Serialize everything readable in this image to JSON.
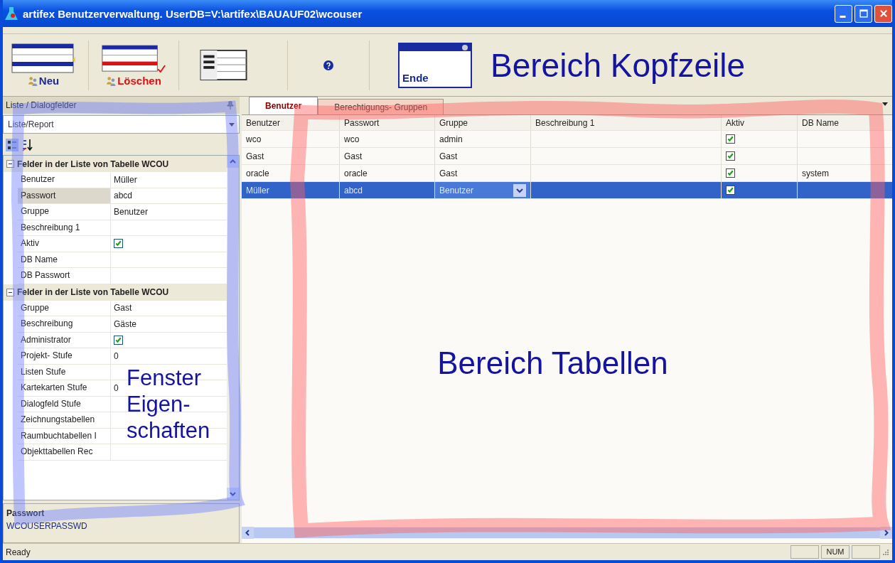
{
  "window": {
    "title": "artifex Benutzerverwaltung. UserDB=V:\\artifex\\BAUAUF02\\wcouser"
  },
  "toolbar": [
    {
      "kind": "new",
      "label": "Neu"
    },
    {
      "kind": "delete",
      "label": "Löschen"
    },
    {
      "kind": "list"
    },
    {
      "kind": "help"
    },
    {
      "kind": "exit",
      "label": "Ende"
    }
  ],
  "annotations": {
    "header": "Bereich Kopfzeile",
    "panel": [
      "Fenster",
      "Eigen-",
      "schaften"
    ],
    "table": "Bereich Tabellen"
  },
  "panel": {
    "title": "Liste / Dialogfelder",
    "dropdown": "Liste/Report",
    "sections": [
      {
        "title": "Felder in der Liste von Tabelle WCOU",
        "expanded": true,
        "rows": [
          {
            "kind": "text",
            "name": "Benutzer",
            "value": "Müller",
            "selected": false
          },
          {
            "kind": "text",
            "name": "Passwort",
            "value": "abcd",
            "selected": true
          },
          {
            "kind": "text",
            "name": "Gruppe",
            "value": "Benutzer",
            "selected": false
          },
          {
            "kind": "text",
            "name": "Beschreibung 1",
            "selected": false
          },
          {
            "kind": "checkbox",
            "name": "Aktiv",
            "checked": true,
            "selected": false
          },
          {
            "kind": "text",
            "name": "DB Name",
            "selected": false
          },
          {
            "kind": "text",
            "name": "DB Passwort",
            "selected": false
          }
        ]
      },
      {
        "title": "Felder in der Liste von Tabelle WCOU",
        "expanded": true,
        "rows": [
          {
            "kind": "text",
            "name": "Gruppe",
            "value": "Gast",
            "selected": false
          },
          {
            "kind": "text",
            "name": "Beschreibung",
            "value": "Gäste",
            "selected": false
          },
          {
            "kind": "checkbox",
            "name": "Administrator",
            "checked": true,
            "selected": false
          },
          {
            "kind": "text",
            "name": "Projekt- Stufe",
            "value": "0",
            "selected": false
          },
          {
            "kind": "text",
            "name": "Listen   Stufe",
            "selected": false
          },
          {
            "kind": "text",
            "name": "Kartekarten Stufe",
            "value": "0",
            "selected": false
          },
          {
            "kind": "text",
            "name": "Dialogfeld Stufe",
            "selected": false
          },
          {
            "kind": "text",
            "name": "Zeichnungstabellen",
            "selected": false
          },
          {
            "kind": "text",
            "name": "Raumbuchtabellen I",
            "selected": false
          },
          {
            "kind": "text",
            "name": "Objekttabellen Rec",
            "selected": false
          }
        ]
      }
    ]
  },
  "description": {
    "title": "Passwort",
    "text": "WCOUSERPASSWD"
  },
  "tabs": [
    {
      "label": "Benutzer",
      "selected": true
    },
    {
      "label": "Berechtigungs- Gruppen",
      "selected": false
    }
  ],
  "table": {
    "columns": [
      "Benutzer",
      "Passwort",
      "Gruppe",
      "Beschreibung 1",
      "Aktiv",
      "DB Name"
    ],
    "rows": [
      {
        "benutzer": "wco",
        "passwort": "wco",
        "gruppe": "admin",
        "aktiv": true,
        "selected": false
      },
      {
        "benutzer": "Gast",
        "passwort": "Gast",
        "gruppe": "Gast",
        "aktiv": true,
        "selected": false
      },
      {
        "benutzer": "oracle",
        "passwort": "oracle",
        "gruppe": "Gast",
        "aktiv": true,
        "db_name": "system",
        "selected": false
      },
      {
        "benutzer": "Müller",
        "passwort": "abcd",
        "gruppe": "Benutzer",
        "aktiv": true,
        "selected": true
      }
    ]
  },
  "status_bar": {
    "text": "Ready",
    "indicators": [
      "NUM"
    ]
  }
}
